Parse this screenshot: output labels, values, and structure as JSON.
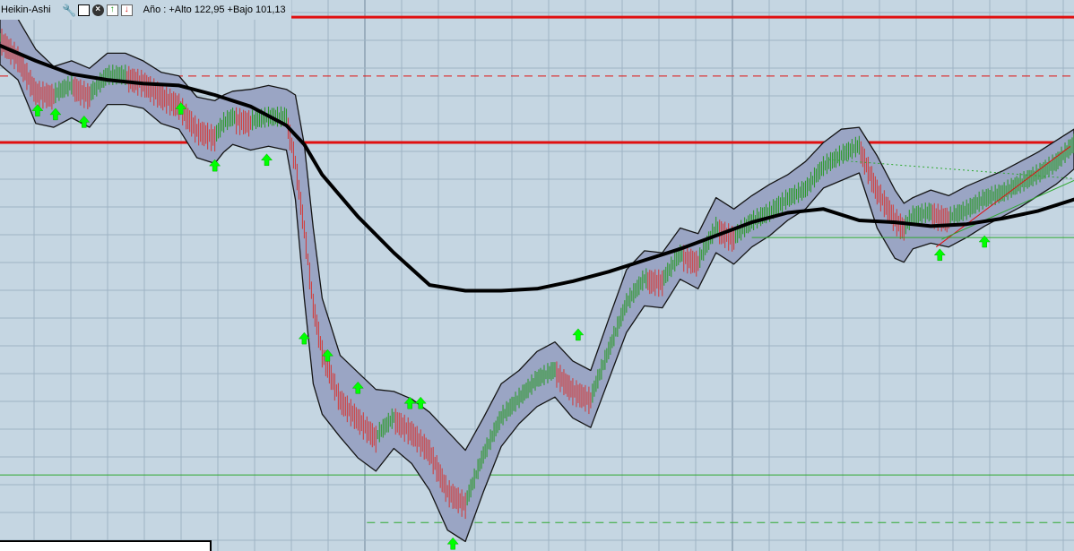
{
  "toolbar": {
    "title": "Heikin-Ashi",
    "info_text": "Año : +Alto 122,95 +Bajo 101,13",
    "icons": [
      "wrench-icon",
      "window-icon",
      "close-icon",
      "arrow-up-icon",
      "arrow-down-icon"
    ]
  },
  "chart_data": {
    "type": "line",
    "candle_style": "Heikin-Ashi",
    "grid": true,
    "year_range": {
      "high": 122.95,
      "low": 101.13
    },
    "ylim": [
      96,
      125
    ],
    "x_count": 600,
    "colors": {
      "background": "#c5d6e2",
      "grid_minor": "#9fb4c4",
      "grid_major": "#6f8799",
      "band_fill": "#9aa5c4",
      "band_edge": "#141414",
      "moving_average": "#000000",
      "resistance": "#e01010",
      "support": "#2fa82f",
      "candle_up": "#2f9a2f",
      "candle_down": "#d04040",
      "signal_arrow": "#00ff00"
    },
    "horizontal_lines": [
      {
        "y": 124.1,
        "color": "#e01010",
        "style": "solid",
        "weight": "thick"
      },
      {
        "y": 121.0,
        "color": "#e01010",
        "style": "dashed",
        "weight": "thin"
      },
      {
        "y": 117.5,
        "color": "#e01010",
        "style": "solid",
        "weight": "thick"
      },
      {
        "y": 100.0,
        "color": "#2fa82f",
        "style": "solid",
        "weight": "thin"
      },
      {
        "y": 97.5,
        "color": "#2fa82f",
        "style": "dashed",
        "weight": "thin",
        "x_from": 205
      }
    ],
    "segments": [
      {
        "x": [
          420,
          600
        ],
        "y": [
          112.5,
          112.5
        ],
        "color": "#2fa82f",
        "style": "solid"
      },
      {
        "x": [
          463,
          600
        ],
        "y": [
          116.6,
          115.6
        ],
        "color": "#2fa82f",
        "style": "dotted"
      },
      {
        "x": [
          523,
          598
        ],
        "y": [
          112.0,
          117.3
        ],
        "color": "#e01010",
        "style": "solid"
      },
      {
        "x": [
          526,
          600
        ],
        "y": [
          112.4,
          115.5
        ],
        "color": "#2fa82f",
        "style": "solid"
      }
    ],
    "price": {
      "x": [
        0,
        10,
        20,
        30,
        40,
        50,
        60,
        70,
        80,
        90,
        100,
        110,
        120,
        125,
        130,
        140,
        150,
        160,
        165,
        170,
        175,
        180,
        190,
        200,
        210,
        220,
        230,
        240,
        250,
        260,
        270,
        280,
        290,
        300,
        310,
        320,
        330,
        340,
        350,
        360,
        370,
        380,
        390,
        400,
        410,
        420,
        430,
        440,
        450,
        460,
        470,
        480,
        490,
        500,
        505,
        510,
        520,
        530,
        540,
        550,
        560,
        570,
        580,
        590,
        600
      ],
      "y": [
        123,
        122,
        120.2,
        120,
        120.5,
        120,
        121,
        121,
        120.7,
        120,
        119.5,
        118.2,
        117.8,
        118.5,
        118.8,
        118.6,
        118.8,
        118.8,
        116.5,
        113,
        109,
        106.5,
        104,
        103,
        102,
        103,
        102.3,
        101.3,
        99.2,
        98.5,
        101,
        103,
        104,
        105,
        105.5,
        104.5,
        104,
        106.5,
        109,
        110.3,
        110.2,
        111.6,
        111.2,
        113,
        112.5,
        113.3,
        113.8,
        114.5,
        115,
        116.2,
        116.8,
        117.3,
        115,
        113.5,
        113,
        113.6,
        113.8,
        113.5,
        113.9,
        114.5,
        114.8,
        115.3,
        115.8,
        116.4,
        117.4
      ]
    },
    "band": {
      "x": [
        0,
        10,
        20,
        30,
        40,
        50,
        60,
        70,
        80,
        90,
        100,
        110,
        120,
        125,
        130,
        140,
        150,
        160,
        165,
        170,
        175,
        180,
        190,
        200,
        210,
        220,
        230,
        240,
        250,
        260,
        270,
        280,
        290,
        300,
        310,
        320,
        330,
        340,
        350,
        360,
        370,
        380,
        390,
        400,
        410,
        420,
        430,
        440,
        450,
        460,
        470,
        480,
        490,
        500,
        505,
        510,
        520,
        530,
        540,
        550,
        560,
        570,
        580,
        590,
        600
      ],
      "upper": [
        124.1,
        124,
        122.4,
        121.5,
        121.8,
        121.4,
        122.2,
        122.2,
        121.8,
        121.2,
        121,
        119.9,
        119.7,
        120,
        120.2,
        120.3,
        120.5,
        120.3,
        120,
        117.4,
        113,
        109.3,
        106.3,
        105.4,
        104.5,
        104.4,
        104,
        103.3,
        102.3,
        101.3,
        103,
        104.8,
        105.5,
        106.5,
        107,
        106,
        105.5,
        108.2,
        110.8,
        111.8,
        111.7,
        113,
        112.7,
        114.6,
        114,
        114.7,
        115.3,
        115.8,
        116.5,
        117.5,
        118.2,
        118.3,
        116.8,
        115,
        114.3,
        114.6,
        115,
        114.7,
        115.2,
        115.6,
        116,
        116.5,
        117,
        117.6,
        118.2
      ],
      "lower": [
        121.6,
        120.8,
        118.5,
        118.3,
        118.8,
        118.3,
        119.5,
        119.5,
        119.3,
        118.5,
        118.2,
        116.7,
        116.4,
        117,
        117.4,
        117.1,
        117.3,
        117.1,
        114.5,
        109.3,
        104.8,
        103.2,
        102,
        100.9,
        100.2,
        101.4,
        100.6,
        99.2,
        97.1,
        96.5,
        99.1,
        101.5,
        102.7,
        103.6,
        104.1,
        103,
        102.5,
        105,
        107.5,
        108.9,
        108.8,
        110.3,
        109.8,
        111.7,
        111.1,
        112,
        112.6,
        113.4,
        114,
        115.1,
        115.5,
        115.9,
        113,
        111.4,
        111.2,
        111.9,
        112.2,
        112,
        112.5,
        113.1,
        113.6,
        114.1,
        114.7,
        115.3,
        116.1
      ]
    },
    "moving_average": {
      "x": [
        0,
        20,
        40,
        60,
        80,
        100,
        120,
        140,
        160,
        170,
        180,
        200,
        220,
        240,
        260,
        280,
        300,
        320,
        340,
        360,
        380,
        400,
        420,
        440,
        460,
        480,
        500,
        520,
        540,
        560,
        580,
        600
      ],
      "y": [
        122.6,
        121.8,
        121.1,
        120.8,
        120.6,
        120.5,
        120.0,
        119.4,
        118.4,
        117.4,
        115.8,
        113.6,
        111.7,
        110.0,
        109.7,
        109.7,
        109.8,
        110.2,
        110.7,
        111.3,
        111.9,
        112.6,
        113.3,
        113.8,
        114.0,
        113.4,
        113.3,
        113.1,
        113.2,
        113.5,
        113.9,
        114.5
      ]
    },
    "signals": {
      "type": "buy-arrow",
      "x": [
        21,
        31,
        47,
        101,
        120,
        149,
        170,
        183,
        200,
        229,
        235,
        253,
        323,
        525,
        550
      ],
      "y": [
        119.5,
        119.3,
        118.9,
        119.6,
        116.6,
        116.9,
        107.5,
        106.6,
        104.9,
        104.1,
        104.1,
        96.7,
        107.7,
        111.9,
        112.6
      ]
    }
  }
}
